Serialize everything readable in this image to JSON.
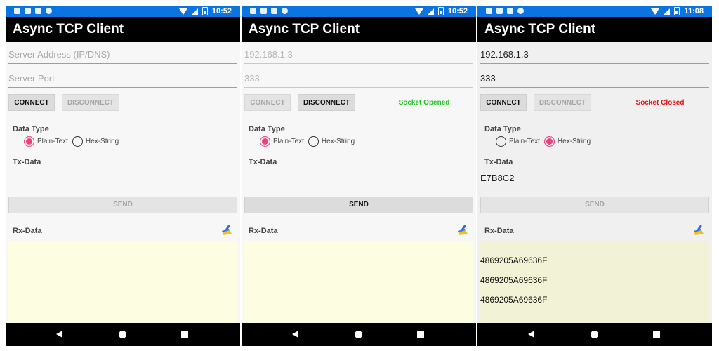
{
  "screens": [
    {
      "status_time": "10:52",
      "title": "Async TCP Client",
      "server_address": {
        "value": "",
        "placeholder": "Server Address (IP/DNS)"
      },
      "server_port": {
        "value": "",
        "placeholder": "Server Port"
      },
      "connect_label": "CONNECT",
      "disconnect_label": "DISCONNECT",
      "socket_status": "",
      "data_type_label": "Data Type",
      "plain_text_label": "Plain-Text",
      "hex_string_label": "Hex-String",
      "tx_label": "Tx-Data",
      "tx_value": "",
      "send_label": "SEND",
      "rx_label": "Rx-Data",
      "rx_lines": []
    },
    {
      "status_time": "10:52",
      "title": "Async TCP Client",
      "server_address": {
        "value": "192.168.1.3",
        "placeholder": ""
      },
      "server_port": {
        "value": "333",
        "placeholder": ""
      },
      "connect_label": "CONNECT",
      "disconnect_label": "DISCONNECT",
      "socket_status": "Socket Opened",
      "data_type_label": "Data Type",
      "plain_text_label": "Plain-Text",
      "hex_string_label": "Hex-String",
      "tx_label": "Tx-Data",
      "tx_value": "",
      "send_label": "SEND",
      "rx_label": "Rx-Data",
      "rx_lines": []
    },
    {
      "status_time": "11:08",
      "title": "Async TCP Client",
      "server_address": {
        "value": "192.168.1.3",
        "placeholder": ""
      },
      "server_port": {
        "value": "333",
        "placeholder": ""
      },
      "connect_label": "CONNECT",
      "disconnect_label": "DISCONNECT",
      "socket_status": "Socket Closed",
      "data_type_label": "Data Type",
      "plain_text_label": "Plain-Text",
      "hex_string_label": "Hex-String",
      "tx_label": "Tx-Data",
      "tx_value": "E7B8C2",
      "send_label": "SEND",
      "rx_label": "Rx-Data",
      "rx_lines": [
        "4869205A69636F",
        "4869205A69636F",
        "4869205A69636F"
      ]
    }
  ],
  "colors": {
    "status_bar": "#0a74e0",
    "app_bar": "#000000",
    "radio_selected": "#e8437f",
    "socket_opened": "#22c122",
    "socket_closed": "#e31414",
    "rx_background": "#fdfde1"
  },
  "icons": {
    "clear_rx": "broom-icon",
    "nav_back": "triangle-back-icon",
    "nav_home": "circle-home-icon",
    "nav_recent": "square-recent-icon"
  }
}
